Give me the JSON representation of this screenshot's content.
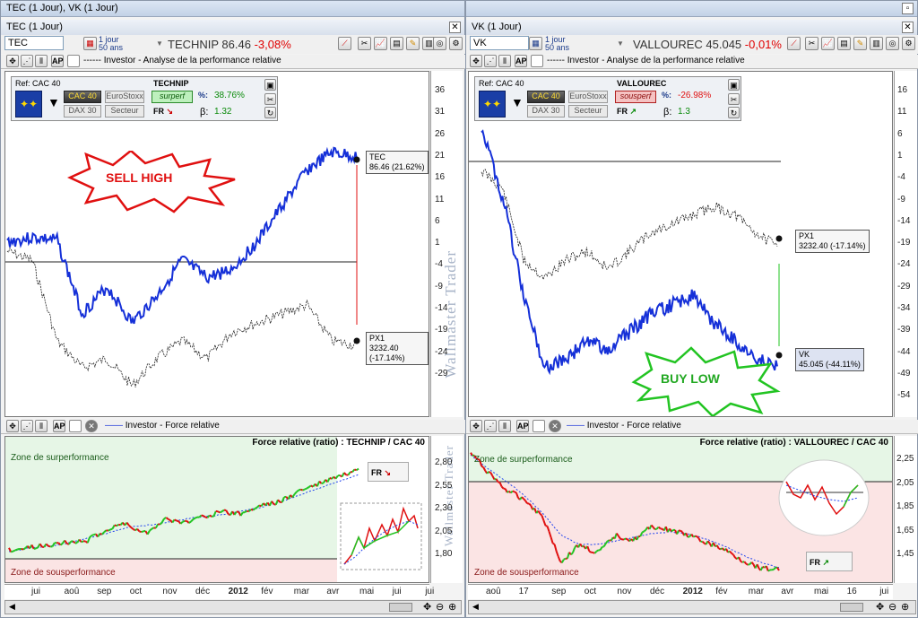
{
  "left": {
    "window_title": "TEC (1 Jour), VK (1 Jour)",
    "pane_title": "TEC (1 Jour)",
    "ticker_value": "TEC",
    "period_label": "1 jour",
    "period_sub": "50 ans",
    "stock_name": "TECHNIP 86.46",
    "stock_change": "-3,08%",
    "indicator": "Investor - Analyse de la performance relative",
    "ref_label": "Ref: CAC 40",
    "btn_cac": "CAC 40",
    "btn_eurostoxx": "EuroStoxx",
    "btn_dax": "DAX 30",
    "btn_secteur": "Secteur",
    "stock_box": "TECHNIP",
    "badge": "surperf",
    "perf_pct": "38.76%",
    "beta_label": "β:",
    "beta": "1.32",
    "fr": "FR",
    "callout": "SELL HIGH",
    "tag_stock_line1": "TEC",
    "tag_stock_line2": "86.46 (21.62%)",
    "tag_idx_line1": "PX1",
    "tag_idx_line2": "3232.40 (-17.14%)",
    "yticks": [
      "36",
      "31",
      "26",
      "21",
      "16",
      "11",
      "6",
      "1",
      "-4",
      "-9",
      "-14",
      "-19",
      "-24",
      "-29"
    ],
    "watermark": "Wallmaster Trader",
    "fr_indicator": "Investor - Force relative",
    "fr_title": "Force relative (ratio) : TECHNIP / CAC 40",
    "zone_sup": "Zone de surperformance",
    "zone_sous": "Zone de sousperformance",
    "fr_yticks": [
      "2,80",
      "2,55",
      "2,30",
      "2,05",
      "1,80"
    ],
    "xlabels": [
      "jui",
      "aoû",
      "sep",
      "oct",
      "nov",
      "déc",
      "2012",
      "fév",
      "mar",
      "avr",
      "mai",
      "jui",
      "jui"
    ]
  },
  "right": {
    "pane_title": "VK (1 Jour)",
    "ticker_value": "VK",
    "period_label": "1 jour",
    "period_sub": "50 ans",
    "stock_name": "VALLOUREC 45.045",
    "stock_change": "-0,01%",
    "indicator": "Investor - Analyse de la performance relative",
    "ref_label": "Ref: CAC 40",
    "btn_cac": "CAC 40",
    "btn_eurostoxx": "EuroStoxx",
    "btn_dax": "DAX 30",
    "btn_secteur": "Secteur",
    "stock_box": "VALLOUREC",
    "badge": "sousperf",
    "perf_pct": "-26.98%",
    "beta_label": "β:",
    "beta": "1.3",
    "fr": "FR",
    "callout": "BUY LOW",
    "tag_stock_line1": "VK",
    "tag_stock_line2": "45.045 (-44.11%)",
    "tag_idx_line1": "PX1",
    "tag_idx_line2": "3232.40 (-17.14%)",
    "yticks": [
      "16",
      "11",
      "6",
      "1",
      "-4",
      "-9",
      "-14",
      "-19",
      "-24",
      "-29",
      "-34",
      "-39",
      "-44",
      "-49",
      "-54"
    ],
    "watermark": "Wallmaster Trader",
    "fr_indicator": "Investor - Force relative",
    "fr_title": "Force relative (ratio) : VALLOUREC / CAC 40",
    "zone_sup": "Zone de surperformance",
    "zone_sous": "Zone de sousperformance",
    "fr_yticks": [
      "2,25",
      "2,05",
      "1,85",
      "1,65",
      "1,45"
    ],
    "xlabels": [
      "aoû",
      "17",
      "sep",
      "oct",
      "nov",
      "déc",
      "2012",
      "fév",
      "mar",
      "avr",
      "mai",
      "16",
      "jui"
    ]
  },
  "colors": {
    "stock": "#1530d8",
    "index": "#222222",
    "up": "#22c422",
    "down": "#e01010",
    "ma": "#2244ee"
  }
}
